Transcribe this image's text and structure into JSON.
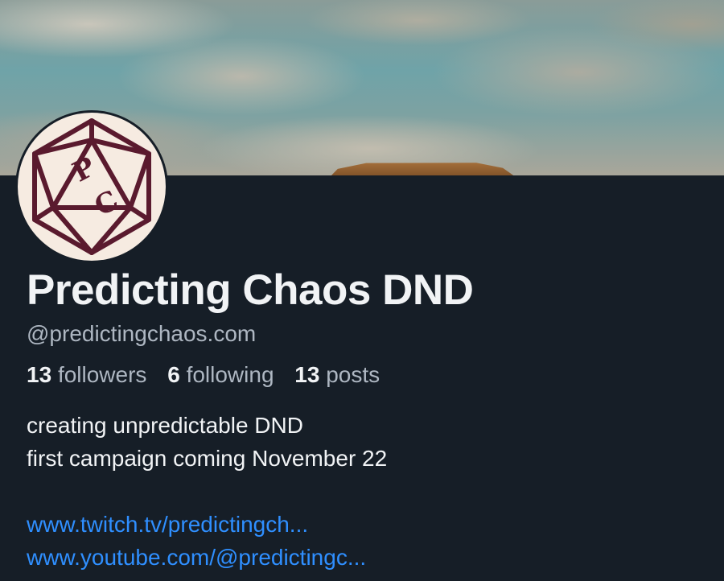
{
  "profile": {
    "display_name": "Predicting Chaos DND",
    "handle": "@predictingchaos.com",
    "avatar_initials": "PC",
    "stats": {
      "followers_count": "13",
      "followers_label": "followers",
      "following_count": "6",
      "following_label": "following",
      "posts_count": "13",
      "posts_label": "posts"
    },
    "bio": {
      "line1": "creating unpredictable DND",
      "line2": "first campaign coming November 22",
      "link1": "www.twitch.tv/predictingch...",
      "link2": "www.youtube.com/@predictingc..."
    }
  },
  "colors": {
    "background": "#161e27",
    "link": "#2f8fff",
    "muted": "#aeb7c2",
    "avatar_ink": "#5a1a2e"
  }
}
